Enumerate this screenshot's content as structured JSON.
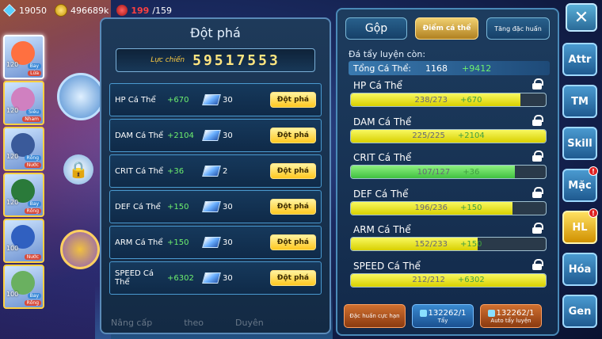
{
  "topbar": {
    "gems": "19050",
    "gold": "496689k",
    "stamina_current": "199",
    "stamina_max": "/159"
  },
  "roster": {
    "pets": [
      {
        "level": "120",
        "tag1": "Bay",
        "tag2": "Lửa",
        "color": "#ff7040"
      },
      {
        "level": "120",
        "tag1": "Siêu",
        "tag2": "Nham",
        "color": "#d080c0"
      },
      {
        "level": "120",
        "tag1": "Rồng",
        "tag2": "Nước",
        "color": "#3a5a9a"
      },
      {
        "level": "120",
        "tag1": "Bay",
        "tag2": "Rồng",
        "color": "#2a7a3a"
      },
      {
        "level": "100",
        "tag1": "",
        "tag2": "Nước",
        "color": "#3060c0"
      },
      {
        "level": "100",
        "tag1": "Bay",
        "tag2": "Rồng",
        "color": "#6ab060"
      }
    ]
  },
  "breakthrough": {
    "title": "Đột phá",
    "power_label": "Lực chiến",
    "power_value": "59517553",
    "rows": [
      {
        "name": "HP Cá Thể",
        "value": "+670",
        "cost": "30",
        "button": "Đột phá"
      },
      {
        "name": "DAM Cá Thể",
        "value": "+2104",
        "cost": "30",
        "button": "Đột phá"
      },
      {
        "name": "CRIT Cá Thể",
        "value": "+36",
        "cost": "2",
        "button": "Đột phá"
      },
      {
        "name": "DEF Cá Thể",
        "value": "+150",
        "cost": "30",
        "button": "Đột phá"
      },
      {
        "name": "ARM Cá Thể",
        "value": "+150",
        "cost": "30",
        "button": "Đột phá"
      },
      {
        "name": "SPEED Cá Thể",
        "value": "+6302",
        "cost": "30",
        "button": "Đột phá"
      }
    ],
    "bottom_tabs": [
      "Nâng cấp",
      "theo",
      "Duyên"
    ]
  },
  "stats_panel": {
    "tabs": {
      "gop": "Gộp",
      "diem": "Điểm cá thể",
      "tang": "Tăng đặc huấn"
    },
    "remain_label": "Đá tẩy luyện còn:",
    "total_label": "Tổng Cá Thể:",
    "total_value": "1168",
    "total_plus": "+9412",
    "stats": [
      {
        "name": "HP Cá Thể",
        "current": "238/273",
        "plus": "+670",
        "fill": 0.87,
        "green": false
      },
      {
        "name": "DAM Cá Thể",
        "current": "225/225",
        "plus": "+2104",
        "fill": 1.0,
        "green": false
      },
      {
        "name": "CRIT Cá Thể",
        "current": "107/127",
        "plus": "+36",
        "fill": 0.84,
        "green": true
      },
      {
        "name": "DEF Cá Thể",
        "current": "196/236",
        "plus": "+150",
        "fill": 0.83,
        "green": false
      },
      {
        "name": "ARM Cá Thể",
        "current": "152/233",
        "plus": "+150",
        "fill": 0.65,
        "green": false
      },
      {
        "name": "SPEED Cá Thể",
        "current": "212/212",
        "plus": "+6302",
        "fill": 1.0,
        "green": false
      }
    ],
    "actions": {
      "special": "Đặc huấn cực hạn",
      "wash_count": "132262/1",
      "wash_label": "Tẩy",
      "auto_count": "132262/1",
      "auto_label": "Auto tẩy luyện"
    }
  },
  "side_menu": {
    "close": "✕",
    "items": [
      {
        "label": "Attr",
        "badge": ""
      },
      {
        "label": "TM",
        "badge": ""
      },
      {
        "label": "Skill",
        "badge": ""
      },
      {
        "label": "Mặc",
        "badge": "!"
      },
      {
        "label": "HL",
        "badge": "!"
      },
      {
        "label": "Hóa",
        "badge": ""
      },
      {
        "label": "Gen",
        "badge": ""
      }
    ]
  }
}
